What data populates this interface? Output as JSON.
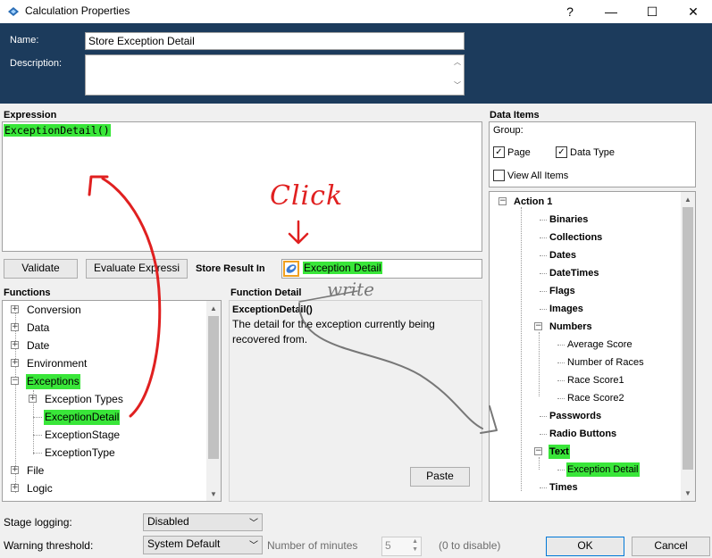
{
  "window": {
    "title": "Calculation Properties",
    "controls": {
      "help": "?",
      "minimize": "—",
      "maximize": "☐",
      "close": "✕"
    }
  },
  "header": {
    "name_label": "Name:",
    "name_value": "Store Exception Detail",
    "description_label": "Description:",
    "description_value": ""
  },
  "expression": {
    "label": "Expression",
    "value": "ExceptionDetail()"
  },
  "toolbar": {
    "validate": "Validate",
    "evaluate": "Evaluate Expressi",
    "store_label": "Store Result In",
    "store_value": "Exception Detail"
  },
  "functions": {
    "label": "Functions",
    "items": [
      {
        "label": "Conversion",
        "expander": "+"
      },
      {
        "label": "Data",
        "expander": "+"
      },
      {
        "label": "Date",
        "expander": "+"
      },
      {
        "label": "Environment",
        "expander": "+"
      },
      {
        "label": "Exceptions",
        "expander": "−"
      },
      {
        "label": "Exception Types",
        "expander": "+"
      },
      {
        "label": "ExceptionDetail"
      },
      {
        "label": "ExceptionStage"
      },
      {
        "label": "ExceptionType"
      },
      {
        "label": "File",
        "expander": "+"
      },
      {
        "label": "Logic",
        "expander": "+"
      }
    ]
  },
  "function_detail": {
    "label": "Function Detail",
    "signature": "ExceptionDetail()",
    "description": "The detail for the exception currently being recovered from.",
    "paste": "Paste"
  },
  "data_items": {
    "label": "Data Items",
    "group_label": "Group:",
    "page_label": "Page",
    "data_type_label": "Data Type",
    "view_all_label": "View All Items",
    "page_checked": true,
    "data_type_checked": true,
    "view_all_checked": false,
    "tree": [
      {
        "label": "Action 1",
        "expander": "−"
      },
      {
        "label": "Binaries"
      },
      {
        "label": "Collections"
      },
      {
        "label": "Dates"
      },
      {
        "label": "DateTimes"
      },
      {
        "label": "Flags"
      },
      {
        "label": "Images"
      },
      {
        "label": "Numbers",
        "expander": "−"
      },
      {
        "label": "Average Score"
      },
      {
        "label": "Number of Races"
      },
      {
        "label": "Race Score1"
      },
      {
        "label": "Race Score2"
      },
      {
        "label": "Passwords"
      },
      {
        "label": "Radio Buttons"
      },
      {
        "label": "Text",
        "expander": "−"
      },
      {
        "label": "Exception Detail"
      },
      {
        "label": "Times"
      }
    ]
  },
  "footer": {
    "stage_logging_label": "Stage logging:",
    "stage_logging_value": "Disabled",
    "warning_label": "Warning threshold:",
    "warning_value": "System Default",
    "minutes_label": "Number of minutes",
    "minutes_value": "5",
    "disable_hint": "(0 to disable)",
    "ok": "OK",
    "cancel": "Cancel"
  },
  "annotations": {
    "click": "Click",
    "write": "write"
  },
  "colors": {
    "header_bg": "#1c3b5c",
    "highlight": "#39e639",
    "annotation_red": "#e02020",
    "annotation_gray": "#777777"
  }
}
